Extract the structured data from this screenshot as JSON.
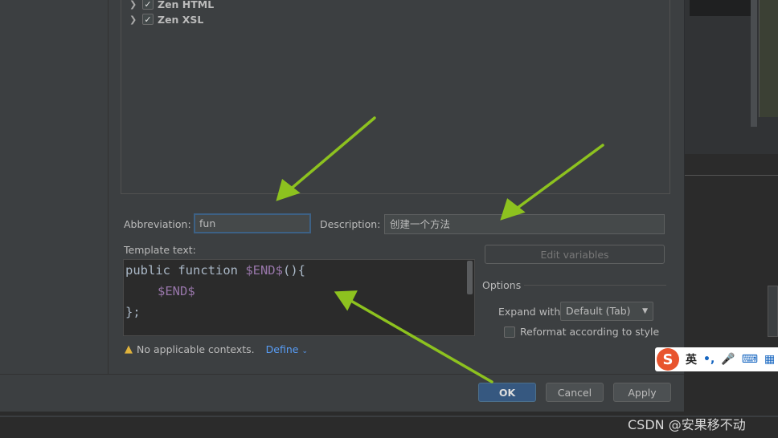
{
  "template_tree": {
    "items": [
      {
        "label": "Zen HTML",
        "checked": true
      },
      {
        "label": "Zen XSL",
        "checked": true
      }
    ]
  },
  "form": {
    "abbreviation_label": "Abbreviation:",
    "abbreviation_value": "fun",
    "description_label": "Description:",
    "description_value": "创建一个方法",
    "template_text_label": "Template text:",
    "code_lines": {
      "l1_text": "public function ",
      "l1_var": "$END$",
      "l1_end": "(){",
      "l2_var": "$END$",
      "l3": "};"
    }
  },
  "options": {
    "edit_variables_label": "Edit variables",
    "section_title": "Options",
    "expand_with_label": "Expand with",
    "expand_with_value": "Default (Tab)",
    "reformat_label": "Reformat according to style",
    "reformat_checked": false
  },
  "contexts": {
    "warning_text": "No applicable contexts.",
    "define_label": "Define"
  },
  "footer": {
    "ok_label": "OK",
    "cancel_label": "Cancel",
    "apply_label": "Apply"
  },
  "ime": {
    "logo": "S",
    "lang": "英",
    "punct": "•,",
    "icons": [
      "mic-icon",
      "keyboard-icon",
      "grid-icon"
    ]
  },
  "watermark": "CSDN @安果移不动",
  "colors": {
    "annotation_arrow": "#8dc21f",
    "primary_button": "#365880",
    "dialog_border": "#a8a33b"
  }
}
